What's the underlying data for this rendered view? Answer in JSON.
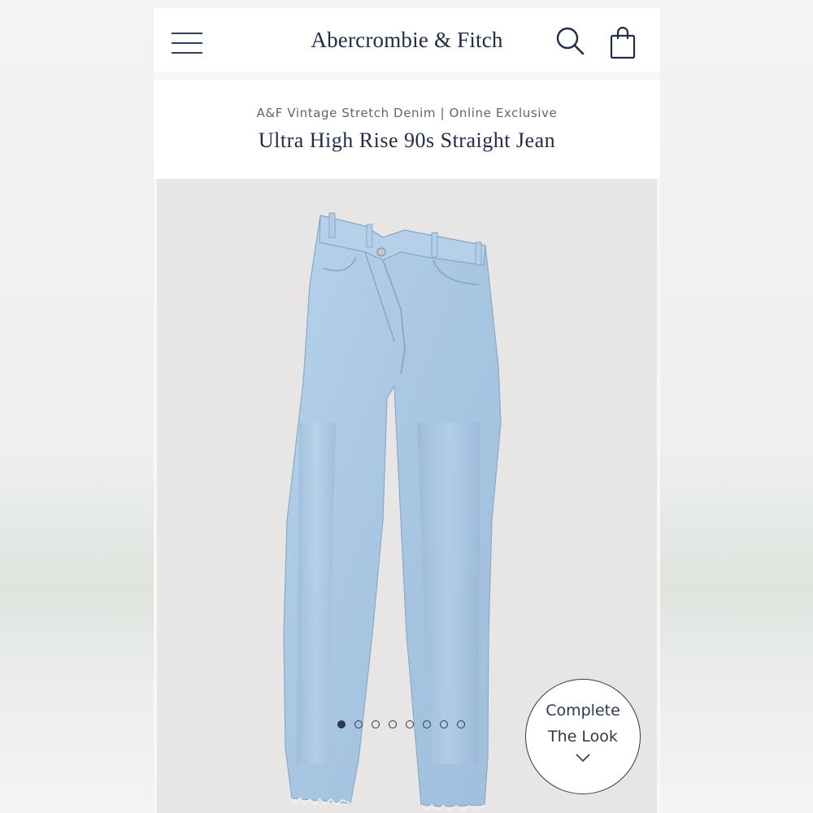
{
  "header": {
    "brand": "Abercrombie & Fitch",
    "icons": [
      "hamburger-menu-icon",
      "search-icon",
      "shopping-bag-icon"
    ]
  },
  "product": {
    "collection": "A&F Vintage Stretch Denim | Online Exclusive",
    "title": "Ultra High Rise 90s Straight Jean"
  },
  "gallery": {
    "image_alt": "light wash straight jeans with criss-cross waistband",
    "slide_count": 8,
    "active_slide": 1
  },
  "complete_the_look": {
    "line1": "Complete",
    "line2": "The Look",
    "icon": "chevron-down-icon"
  },
  "colors": {
    "navy": "#1f2d48",
    "denim": "#a9c8e3",
    "backdrop": "#e8e6e4"
  }
}
